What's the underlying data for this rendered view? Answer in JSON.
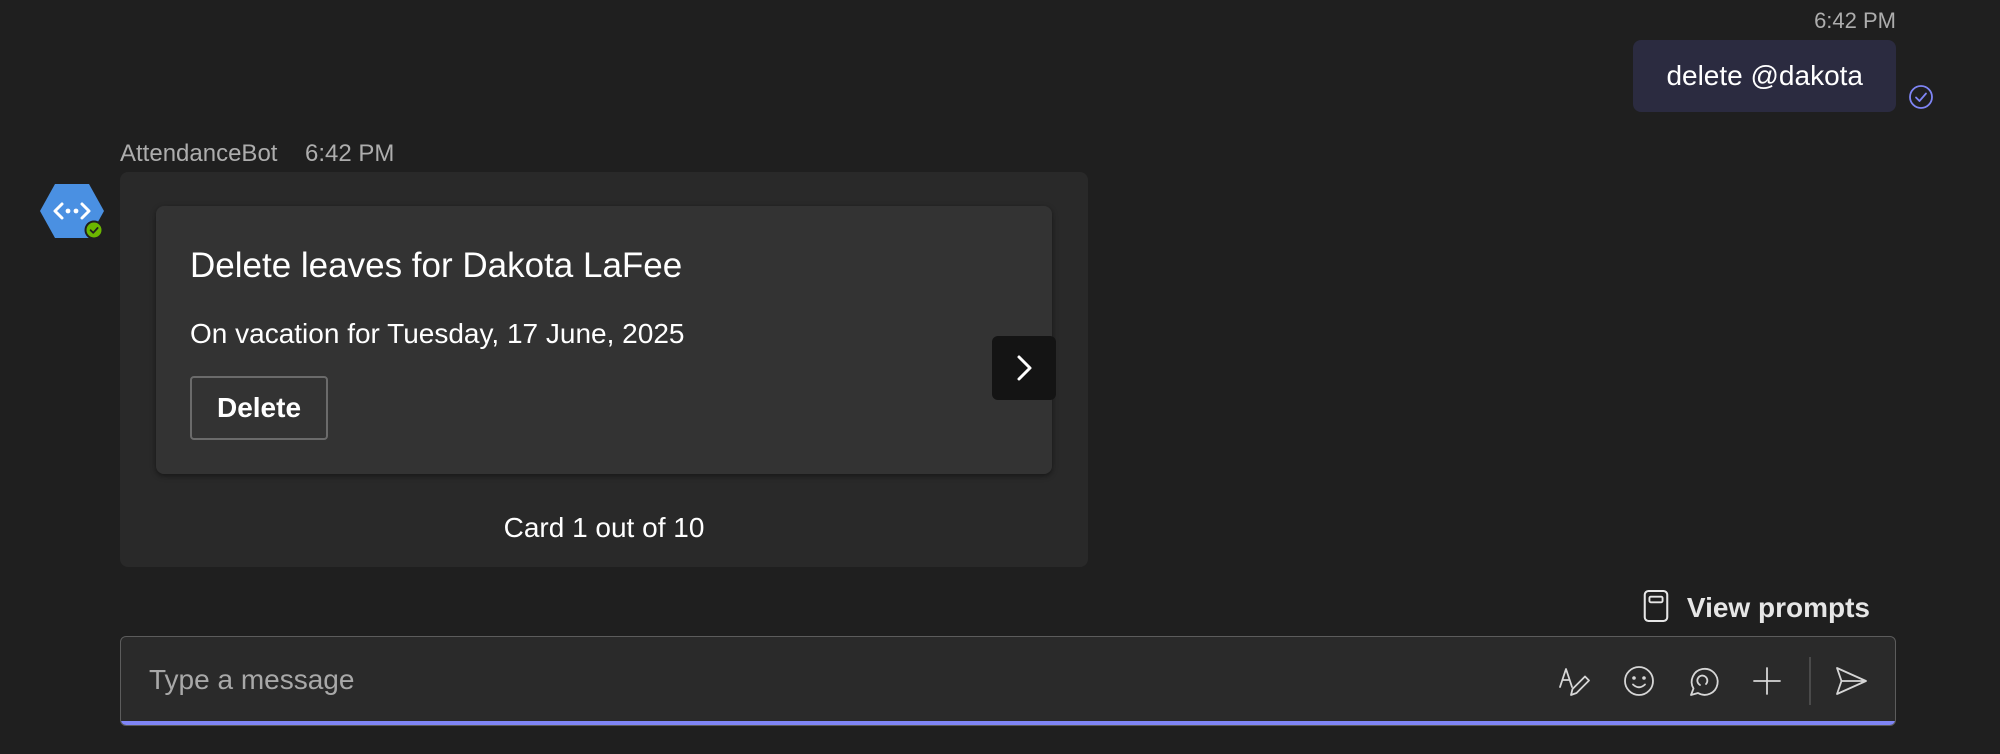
{
  "outgoing": {
    "time": "6:42 PM",
    "text": "delete @dakota"
  },
  "bot": {
    "name": "AttendanceBot",
    "time": "6:42 PM"
  },
  "card": {
    "title": "Delete leaves for Dakota LaFee",
    "subtitle": "On vacation for Tuesday, 17 June, 2025",
    "delete_label": "Delete",
    "counter": "Card 1 out of 10"
  },
  "prompts": {
    "label": "View prompts"
  },
  "compose": {
    "placeholder": "Type a message"
  },
  "icons": {
    "read": "check-circle-icon",
    "avatar": "code-hexagon-icon",
    "next": "chevron-right-icon",
    "prompts": "notebook-icon",
    "format": "format-pen-icon",
    "emoji": "emoji-icon",
    "loop": "loop-icon",
    "attach": "plus-icon",
    "send": "send-icon"
  },
  "colors": {
    "background": "#1f1f1f",
    "accent": "#7f85f5",
    "avatar": "#4a90e2",
    "online": "#6bb700",
    "outgoing_bubble": "#2b2b40"
  }
}
